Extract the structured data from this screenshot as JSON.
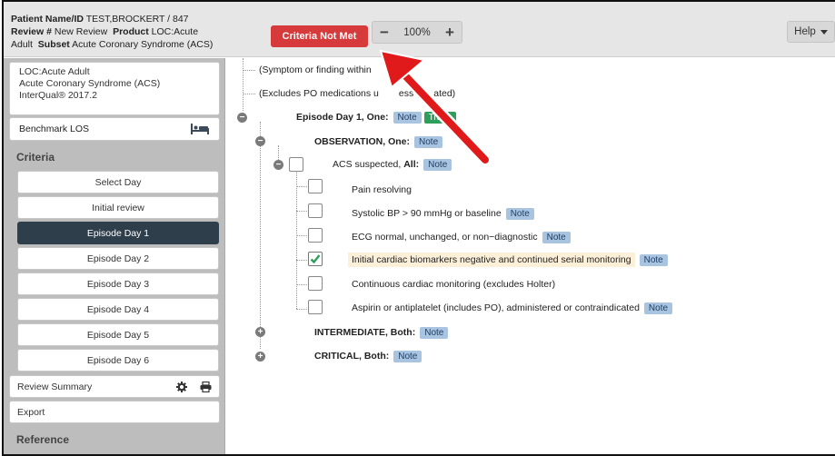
{
  "header": {
    "patient_label": "Patient Name/ID",
    "patient_value": "TEST,BROCKERT / 847",
    "review_label": "Review #",
    "review_value": "New Review",
    "product_label": "Product",
    "product_value_1": "LOC:Acute",
    "product_value_2": "Adult",
    "subset_label": "Subset",
    "subset_value": "Acute Coronary Syndrome (ACS)",
    "criteria_button": "Criteria Not Met",
    "zoom_minus": "−",
    "zoom_value": "100%",
    "zoom_plus": "+",
    "help_button": "Help"
  },
  "sidebar": {
    "loc_line1": "LOC:Acute Adult",
    "loc_line2": "Acute Coronary Syndrome (ACS)",
    "loc_line3": "InterQual® 2017.2",
    "benchmark_label": "Benchmark LOS",
    "criteria_heading": "Criteria",
    "items": [
      {
        "label": "Select Day"
      },
      {
        "label": "Initial review"
      },
      {
        "label": "Episode Day 1"
      },
      {
        "label": "Episode Day 2"
      },
      {
        "label": "Episode Day 3"
      },
      {
        "label": "Episode Day 4"
      },
      {
        "label": "Episode Day 5"
      },
      {
        "label": "Episode Day 6"
      }
    ],
    "active_index": 2,
    "review_summary": "Review Summary",
    "export": "Export",
    "reference_heading": "Reference"
  },
  "tree": {
    "line_symptom": "(Symptom or finding within",
    "line_excludes_a": "(Excludes PO medications u",
    "line_excludes_b": "ess",
    "line_excludes_c": "ated)",
    "episode_day": "Episode Day 1, One:",
    "observation": "OBSERVATION, One:",
    "acs_suspected_a": "ACS suspected,",
    "acs_suspected_b": "All:",
    "criteria": [
      {
        "label": "Pain resolving",
        "checked": false,
        "note": false
      },
      {
        "label": "Systolic BP > 90 mmHg or baseline",
        "checked": false,
        "note": true
      },
      {
        "label": "ECG normal, unchanged, or non−diagnostic",
        "checked": false,
        "note": true
      },
      {
        "label": "Initial cardiac biomarkers negative and continued serial monitoring",
        "checked": true,
        "note": true
      },
      {
        "label": "Continuous cardiac monitoring (excludes Holter)",
        "checked": false,
        "note": false
      },
      {
        "label": "Aspirin or antiplatelet (includes PO), administered or contraindicated",
        "checked": false,
        "note": true
      }
    ],
    "intermediate": "INTERMEDIATE, Both:",
    "critical": "CRITICAL, Both:",
    "note_label": "Note",
    "trans_label": "Trans"
  },
  "colors": {
    "criteria_button": "#d63a3a",
    "active_item": "#2f3e4b",
    "note_badge": "#a8c4e0",
    "trans_badge": "#2e9e5b",
    "arrow": "#e01a1a",
    "highlight_row": "#fdf0d9"
  }
}
